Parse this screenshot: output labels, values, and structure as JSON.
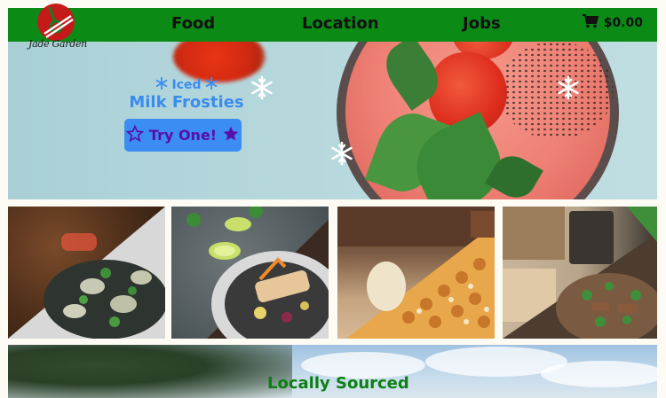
{
  "nav": {
    "logo_text": "Jade Garden",
    "links": [
      {
        "label": "Food"
      },
      {
        "label": "Location"
      },
      {
        "label": "Jobs"
      }
    ],
    "cart": {
      "icon": "shopping-cart-icon",
      "amount": "$0.00"
    }
  },
  "hero": {
    "promo_line1": "Iced",
    "promo_line2": "Milk Frosties",
    "cta_label": "Try One!",
    "cta_icon": "star-icon",
    "decor_icon": "snowflake-icon"
  },
  "tiles": [
    {
      "name": "mussels-dish"
    },
    {
      "name": "fish-dish"
    },
    {
      "name": "fried-dish"
    },
    {
      "name": "noodle-dish"
    }
  ],
  "section": {
    "title": "Locally Sourced"
  },
  "colors": {
    "nav_bg": "#0b8a16",
    "promo_text": "#3b8cf0",
    "cta_bg": "#3b8df2",
    "cta_text": "#5a0ea8",
    "section_title": "#0b7f12",
    "logo_red": "#c51a1a"
  }
}
